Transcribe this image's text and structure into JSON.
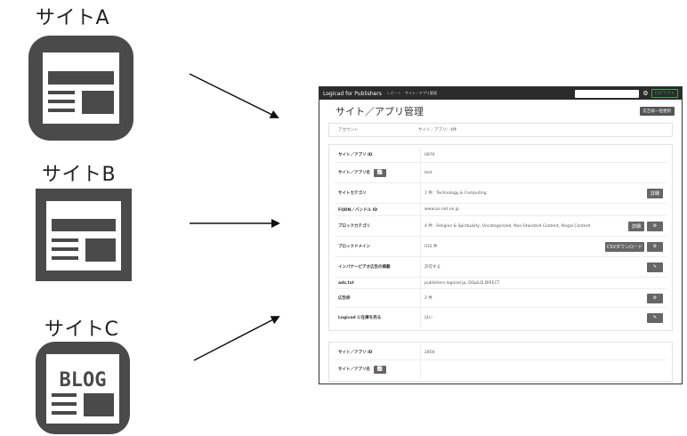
{
  "sites": [
    {
      "label": "サイトA",
      "icon": "newspaper-icon"
    },
    {
      "label": "サイトB",
      "icon": "newspaper-icon"
    },
    {
      "label": "サイトC",
      "icon": "blog-icon",
      "icon_text": "BLOG"
    }
  ],
  "colors": {
    "icon": "#4a4a4a",
    "topbar": "#2b2b2b",
    "button": "#666666",
    "logout": "#3aa655"
  },
  "app": {
    "brand": "Logicad for Publishers",
    "nav": [
      "レポート",
      "サイト／アプリ管理"
    ],
    "logout": "ログアウト",
    "title": "サイト／アプリ管理",
    "bulk_button": "広告枠一括更新",
    "account_label": "アカウント",
    "account_value": "サイト／アプリ：4件",
    "card1": {
      "rows": [
        {
          "key": "サイト／アプリ ID",
          "value": "0970"
        },
        {
          "key": "サイト／アプリ名",
          "value": "test"
        },
        {
          "key": "サイトカテゴリ",
          "value": "1 件：Technology & Computing",
          "action": "詳細"
        },
        {
          "key": "FQDN／バンドル ID",
          "value": "www.so-net.ne.jp"
        },
        {
          "key": "ブロックカテゴリ",
          "value": "4 件：Religion & Spirituality, Uncategorized, Non-Standard Content, Illegal Content",
          "action": "詳細"
        },
        {
          "key": "ブロックドメイン",
          "value": "032 件",
          "action": "CSVダウンロード"
        },
        {
          "key": "インバナービデオ広告の掲載",
          "value": "許可する"
        },
        {
          "key": "ads.txt",
          "value": "publishers.logicad.jp, DGpiLD,DIRECT"
        },
        {
          "key": "広告枠",
          "value": "2 件"
        },
        {
          "key": "Logicad に在庫を売る",
          "value": "はい"
        }
      ]
    },
    "card2": {
      "rows": [
        {
          "key": "サイト／アプリ ID",
          "value": "2856"
        },
        {
          "key": "サイト／アプリ名",
          "value": ""
        }
      ]
    }
  }
}
